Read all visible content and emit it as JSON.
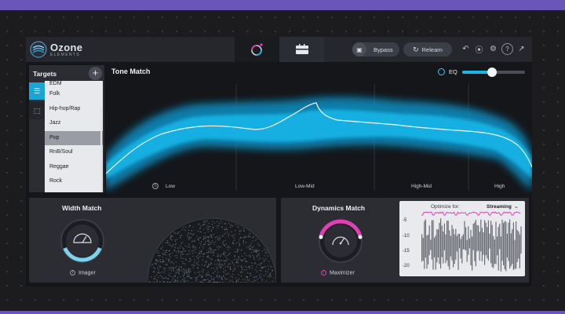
{
  "header": {
    "brand": "Ozone",
    "brand_sub": "ELEMENTS",
    "bypass_label": "Bypass",
    "relearn_label": "Relearn",
    "accent": "#17a6d6"
  },
  "targets": {
    "title": "Targets",
    "genres": [
      "EDM",
      "Folk",
      "Hip-hop/Rap",
      "Jazz",
      "Pop",
      "RnB/Soul",
      "Reggae",
      "Rock"
    ],
    "selected": "Pop"
  },
  "tone_match": {
    "title": "Tone Match",
    "eq_label": "EQ",
    "eq_amount_percent": 48,
    "bands": [
      "Low",
      "Low-Mid",
      "High-Mid",
      "High"
    ]
  },
  "width_match": {
    "title": "Width Match",
    "module_label": "Imager",
    "knob_level_percent": 42
  },
  "dynamics_match": {
    "title": "Dynamics Match",
    "module_label": "Maximizer",
    "optimize_label": "Optimize for:",
    "optimize_value": "Streaming",
    "db_ticks": [
      "-5",
      "-10",
      "-15",
      "-20"
    ],
    "highlight_color": "#e23fb5"
  },
  "colors": {
    "background": "#1c1c1f",
    "frame": "#6a55b8",
    "panel": "#2b2d33",
    "cyan": "#19b6e8"
  }
}
